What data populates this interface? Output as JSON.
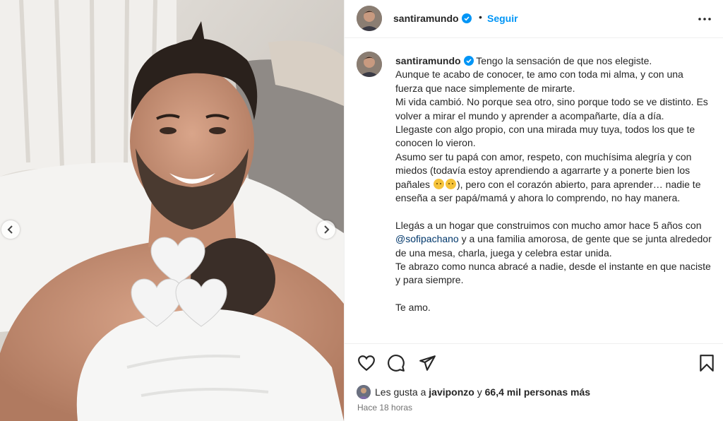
{
  "post": {
    "username": "santiramundo",
    "dot": "•",
    "follow_label": "Seguir",
    "more_icon": "more-horizontal-icon"
  },
  "caption": {
    "username": "santiramundo",
    "lines": [
      "Tengo la sensación de que nos elegiste.",
      "Aunque te acabo de conocer, te amo con toda mi alma, y con una fuerza que nace simplemente de mirarte.",
      "Mi vida cambió. No porque sea otro, sino porque todo se ve distinto. Es volver a mirar el mundo y aprender a acompañarte, día a día.",
      "Llegaste con algo propio, con una mirada muy tuya, todos los que te conocen lo vieron.",
      "Asumo ser tu papá con amor, respeto, con muchísima alegría y con miedos (todavía estoy aprendiendo a agarrarte y a ponerte bien los pañales",
      "), pero con el corazón abierto, para aprender… nadie te enseña a ser papá/mamá y ahora lo comprendo, no hay manera.",
      "Llegás a un hogar que construimos con mucho amor hace 5 años con",
      "@sofipachano",
      "y a una familia amorosa, de gente que se junta alrededor de una mesa, charla, juega y celebra estar unida.",
      "Te abrazo como nunca abracé a nadie, desde el instante en que naciste y para siempre.",
      "Te amo."
    ]
  },
  "likes": {
    "prefix": "Les gusta a",
    "user": "javiponzo",
    "connector": "y",
    "others": "66,4 mil personas más"
  },
  "timestamp": "Hace 18 horas",
  "colors": {
    "accent": "#0095f6",
    "verified": "#0095f6",
    "mention": "#00376b",
    "muted": "#737373"
  },
  "icons": [
    "heart-icon",
    "comment-icon",
    "share-icon",
    "bookmark-icon",
    "chevron-left-icon",
    "chevron-right-icon",
    "verified-badge-icon"
  ]
}
